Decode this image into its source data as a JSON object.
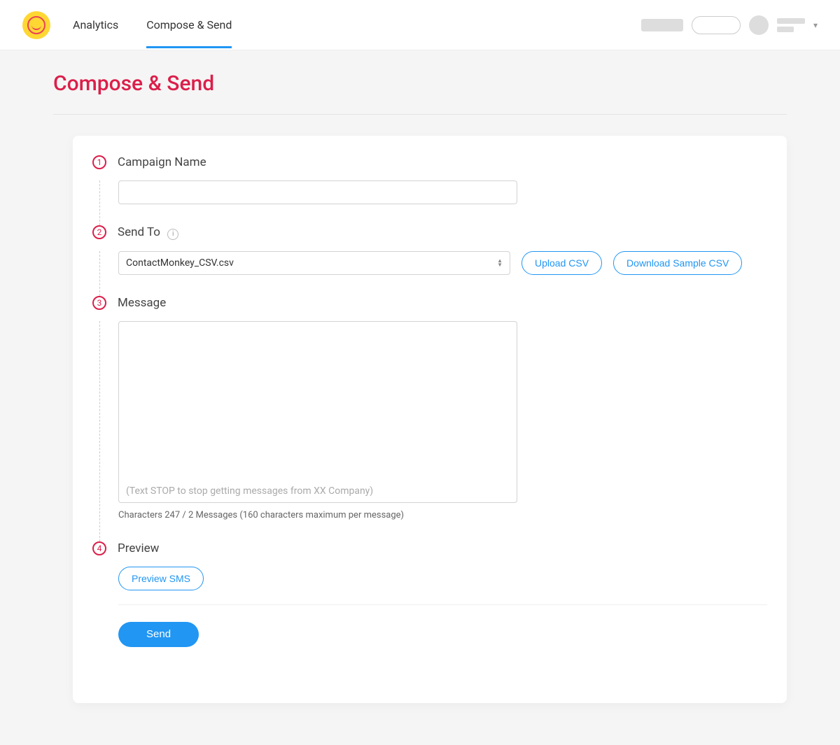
{
  "nav": {
    "analytics": "Analytics",
    "compose": "Compose & Send"
  },
  "page": {
    "title": "Compose & Send"
  },
  "steps": {
    "campaign": {
      "num": "1",
      "label": "Campaign Name",
      "value": ""
    },
    "sendto": {
      "num": "2",
      "label": "Send To",
      "selected": "ContactMonkey_CSV.csv",
      "upload_label": "Upload CSV",
      "download_label": "Download Sample CSV"
    },
    "message": {
      "num": "3",
      "label": "Message",
      "value": "",
      "footer": "(Text STOP to stop getting messages from XX Company)",
      "char_info": "Characters 247 / 2 Messages  (160 characters maximum per message)"
    },
    "preview": {
      "num": "4",
      "label": "Preview",
      "preview_button": "Preview SMS"
    }
  },
  "actions": {
    "send": "Send"
  }
}
